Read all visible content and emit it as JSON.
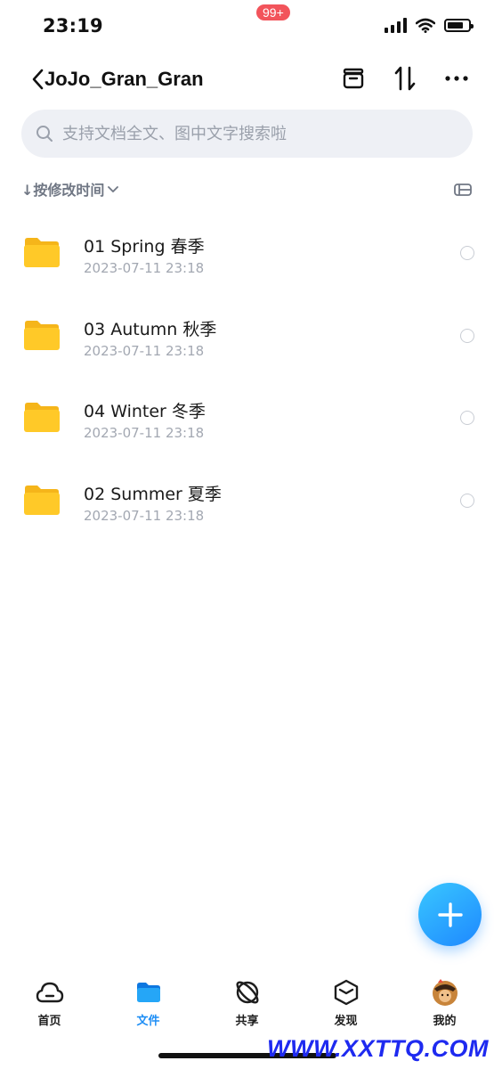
{
  "status_bar": {
    "time": "23:19"
  },
  "header": {
    "back_icon": "chevron-left-icon",
    "title": "JoJo_Gran_Gran",
    "actions": [
      "archive-icon",
      "sort-arrows-icon",
      "more-icon"
    ]
  },
  "search": {
    "placeholder": "支持文档全文、图中文字搜索啦"
  },
  "sort": {
    "label": "↓按修改时间"
  },
  "files": [
    {
      "name": "01 Spring 春季",
      "date": "2023-07-11 23:18"
    },
    {
      "name": "03 Autumn 秋季",
      "date": "2023-07-11 23:18"
    },
    {
      "name": "04 Winter 冬季",
      "date": "2023-07-11 23:18"
    },
    {
      "name": "02 Summer 夏季",
      "date": "2023-07-11 23:18"
    }
  ],
  "tabs": [
    {
      "label": "首页",
      "icon": "cloud-icon",
      "active": false
    },
    {
      "label": "文件",
      "icon": "folder-icon",
      "active": true
    },
    {
      "label": "共享",
      "icon": "share-orbit-icon",
      "active": false,
      "badge": "99+"
    },
    {
      "label": "发现",
      "icon": "cube-icon",
      "active": false
    },
    {
      "label": "我的",
      "icon": "avatar-icon",
      "active": false
    }
  ],
  "colors": {
    "accent": "#1e8ef5",
    "badge": "#f2545b",
    "folder": "#ffc928"
  },
  "watermark": "WWW.XXTTQ.COM"
}
